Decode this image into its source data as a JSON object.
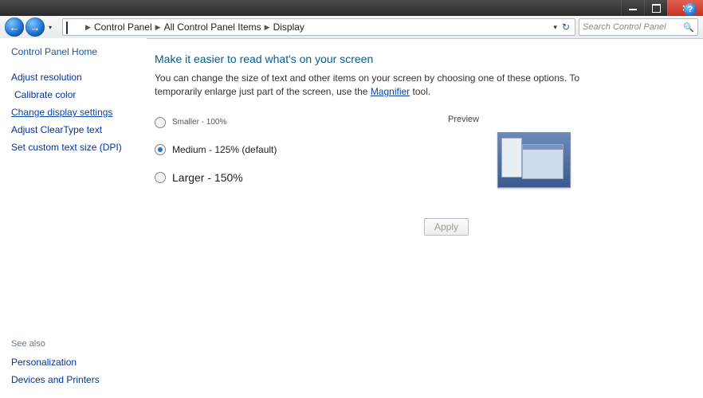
{
  "window": {
    "title": "Display"
  },
  "breadcrumb": {
    "items": [
      "Control Panel",
      "All Control Panel Items",
      "Display"
    ]
  },
  "search": {
    "placeholder": "Search Control Panel"
  },
  "sidebar": {
    "home": "Control Panel Home",
    "links": {
      "adjust_resolution": "Adjust resolution",
      "calibrate_color": "Calibrate color",
      "change_display_settings": "Change display settings",
      "adjust_cleartype": "Adjust ClearType text",
      "custom_dpi": "Set custom text size (DPI)"
    },
    "see_also_hdr": "See also",
    "see_also": {
      "personalization": "Personalization",
      "devices_printers": "Devices and Printers"
    }
  },
  "main": {
    "heading": "Make it easier to read what's on your screen",
    "desc1": "You can change the size of text and other items on your screen by choosing one of these options. To temporarily enlarge just part of the screen, use the ",
    "desc_link": "Magnifier",
    "desc2": " tool.",
    "preview_label": "Preview",
    "options": {
      "smaller": "Smaller - 100%",
      "medium": "Medium - 125% (default)",
      "larger": "Larger - 150%"
    },
    "selected": "medium",
    "apply_label": "Apply"
  }
}
